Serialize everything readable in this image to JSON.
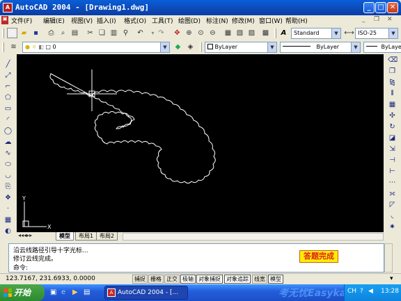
{
  "window": {
    "app_icon": "autocad-logo-icon",
    "title": "AutoCAD 2004 - [Drawing1.dwg]"
  },
  "menu": [
    "文件(F)",
    "编辑(E)",
    "视图(V)",
    "插入(I)",
    "格式(O)",
    "工具(T)",
    "绘图(D)",
    "标注(N)",
    "修改(M)",
    "窗口(W)",
    "帮助(H)"
  ],
  "toolbar": {
    "text_style": "Standard",
    "dim_style": "ISO-25",
    "layer": "0",
    "color": "ByLayer",
    "linetype": "ByLayer",
    "lineweight": "ByLayer"
  },
  "layout_tabs": [
    "模型",
    "布局1",
    "布局2"
  ],
  "command": {
    "lines": [
      "沿云线路径引导十字光标...",
      "修订云线完成。",
      "命令:"
    ],
    "badge": "答题完成"
  },
  "status": {
    "coords": "123.7167, 231.6933, 0.0000",
    "buttons": [
      {
        "label": "捕捉",
        "on": false
      },
      {
        "label": "栅格",
        "on": false
      },
      {
        "label": "正交",
        "on": false
      },
      {
        "label": "极轴",
        "on": true
      },
      {
        "label": "对象捕捉",
        "on": true
      },
      {
        "label": "对象追踪",
        "on": true
      },
      {
        "label": "线宽",
        "on": false
      },
      {
        "label": "模型",
        "on": true
      }
    ]
  },
  "taskbar": {
    "start_label": "开始",
    "task_item": "AutoCAD 2004 - [...",
    "watermark": "考无忧Easykao",
    "ime": "CH",
    "clock": "13:28"
  },
  "ucs": {
    "x_label": "X",
    "y_label": "Y"
  }
}
